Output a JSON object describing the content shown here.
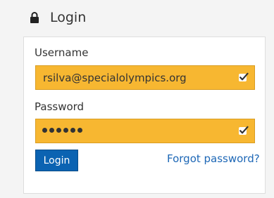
{
  "header": {
    "title": "Login",
    "icon": "lock-icon"
  },
  "form": {
    "username": {
      "label": "Username",
      "value": "rsilva@specialolympics.org",
      "status_icon": "check-icon"
    },
    "password": {
      "label": "Password",
      "masked_length": 6,
      "status_icon": "check-icon"
    },
    "login_button": "Login",
    "forgot_password": "Forgot password?"
  },
  "colors": {
    "autofill_background": "#f7b731",
    "primary_button": "#0b63b2",
    "link": "#1d67b6"
  }
}
